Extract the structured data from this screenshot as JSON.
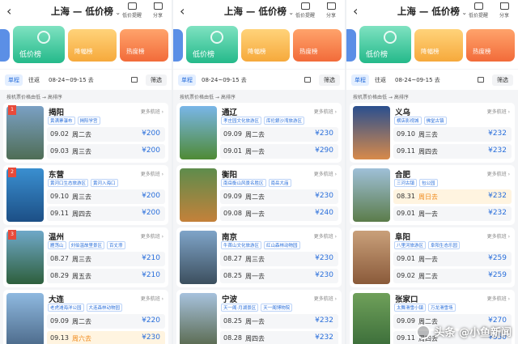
{
  "watermark": "头条 @小鱼新闻",
  "panels": [
    {
      "title": "上海 — 低价榜",
      "tools": [
        "低价提醒",
        "分享"
      ],
      "cards": [
        "低价榜",
        "降幅榜",
        "热度榜"
      ],
      "filters": {
        "chips": [
          "单程",
          "往返"
        ],
        "active_chip": 0,
        "daterange": "08-24~09-15 去",
        "filter": "筛选"
      },
      "sort": "按机票价格由低 → 高排序",
      "items": [
        {
          "rank": "1",
          "city": "揭阳",
          "tags": [
            "黄满寨瀑布",
            "揭阳学宫"
          ],
          "thumb": [
            "#7aa0c4",
            "#4f6d55"
          ],
          "rows": [
            {
              "date": "09.02",
              "day": "周二去",
              "price": "¥200"
            },
            {
              "date": "09.03",
              "day": "周三去",
              "price": "¥200"
            }
          ]
        },
        {
          "rank": "2",
          "city": "东营",
          "tags": [
            "黄河口生态旅游区",
            "黄河入海口"
          ],
          "thumb": [
            "#3a8fd0",
            "#1c4f86"
          ],
          "rows": [
            {
              "date": "09.10",
              "day": "周三去",
              "price": "¥200"
            },
            {
              "date": "09.11",
              "day": "周四去",
              "price": "¥200"
            }
          ]
        },
        {
          "rank": "3",
          "city": "温州",
          "tags": [
            "雁荡山",
            "刘伯温故里景区",
            "百丈漈"
          ],
          "thumb": [
            "#6fa8c8",
            "#2e5f3c"
          ],
          "rows": [
            {
              "date": "08.27",
              "day": "周三去",
              "price": "¥210"
            },
            {
              "date": "08.29",
              "day": "周五去",
              "price": "¥210"
            }
          ]
        },
        {
          "rank": "",
          "city": "大连",
          "tags": [
            "老虎滩海洋公园",
            "大连森林动物园"
          ],
          "thumb": [
            "#8fb9e0",
            "#4c6a8a"
          ],
          "rows": [
            {
              "date": "09.09",
              "day": "周二去",
              "price": "¥220"
            },
            {
              "date": "09.13",
              "day": "周六去",
              "price": "¥230",
              "hl": true
            }
          ]
        }
      ]
    },
    {
      "title": "上海 — 低价榜",
      "tools": [
        "低价提醒",
        "分享"
      ],
      "cards": [
        "低价榜",
        "降幅榜",
        "热度榜"
      ],
      "filters": {
        "chips": [
          "单程"
        ],
        "active_chip": 0,
        "daterange": "08-24~09-15 去",
        "filter": "筛选"
      },
      "sort": "按机票价格由低 → 高排序",
      "items": [
        {
          "rank": "",
          "city": "通辽",
          "tags": [
            "孝庄园文化旅游区",
            "库伦銀沙湾旅游区"
          ],
          "thumb": [
            "#79b6e8",
            "#4f8a35"
          ],
          "rows": [
            {
              "date": "09.09",
              "day": "周二去",
              "price": "¥230"
            },
            {
              "date": "09.01",
              "day": "周一去",
              "price": "¥290"
            }
          ]
        },
        {
          "rank": "",
          "city": "衡阳",
          "tags": [
            "南岳衡山风景名胜区",
            "南岳大庙"
          ],
          "thumb": [
            "#5e8c4c",
            "#c4813a"
          ],
          "rows": [
            {
              "date": "09.09",
              "day": "周二去",
              "price": "¥230"
            },
            {
              "date": "09.08",
              "day": "周一去",
              "price": "¥240"
            }
          ]
        },
        {
          "rank": "",
          "city": "南京",
          "tags": [
            "牛首山文化旅游区",
            "红山森林动物园"
          ],
          "thumb": [
            "#7fa4c8",
            "#3c4f5e"
          ],
          "rows": [
            {
              "date": "08.27",
              "day": "周三去",
              "price": "¥230"
            },
            {
              "date": "08.25",
              "day": "周一去",
              "price": "¥230"
            }
          ]
        },
        {
          "rank": "",
          "city": "宁波",
          "tags": [
            "天一阁·月湖景区",
            "天一阁博物院"
          ],
          "thumb": [
            "#a7c2dd",
            "#5a6a4f"
          ],
          "rows": [
            {
              "date": "08.25",
              "day": "周一去",
              "price": "¥232"
            },
            {
              "date": "08.28",
              "day": "周四去",
              "price": "¥232"
            }
          ]
        }
      ]
    },
    {
      "title": "上海 — 低价榜",
      "tools": [
        "低价提醒",
        "分享"
      ],
      "cards": [
        "低价榜",
        "降幅榜",
        "热度榜"
      ],
      "filters": {
        "chips": [
          "单程",
          "往返"
        ],
        "active_chip": 0,
        "daterange": "08-24~09-15 去",
        "filter": "筛选"
      },
      "sort": "按机票价格由低 → 高排序",
      "items": [
        {
          "rank": "",
          "city": "义乌",
          "tags": [
            "横店影视城",
            "佛堂古镇"
          ],
          "thumb": [
            "#2a4f8f",
            "#d88a4a"
          ],
          "rows": [
            {
              "date": "09.10",
              "day": "周三去",
              "price": "¥232"
            },
            {
              "date": "09.11",
              "day": "周四去",
              "price": "¥232"
            }
          ]
        },
        {
          "rank": "",
          "city": "合肥",
          "tags": [
            "三河古镇",
            "包公园"
          ],
          "thumb": [
            "#9fc0d8",
            "#5b7c4a"
          ],
          "rows": [
            {
              "date": "08.31",
              "day": "周日去",
              "price": "¥232",
              "hl": true
            },
            {
              "date": "09.01",
              "day": "周一去",
              "price": "¥232"
            }
          ]
        },
        {
          "rank": "",
          "city": "阜阳",
          "tags": [
            "八里河旅游区",
            "阜阳生态乐园"
          ],
          "thumb": [
            "#c9a07a",
            "#8a5a3a"
          ],
          "rows": [
            {
              "date": "09.01",
              "day": "周一去",
              "price": "¥259"
            },
            {
              "date": "09.02",
              "day": "周二去",
              "price": "¥259"
            }
          ]
        },
        {
          "rank": "",
          "city": "张家口",
          "tags": [
            "太舞滑雪小镇",
            "万龙滑雪场"
          ],
          "thumb": [
            "#6fa05a",
            "#3c6e3a"
          ],
          "rows": [
            {
              "date": "09.09",
              "day": "周二去",
              "price": "¥270"
            },
            {
              "date": "09.11",
              "day": "周四去",
              "price": "¥350"
            }
          ]
        }
      ]
    }
  ]
}
